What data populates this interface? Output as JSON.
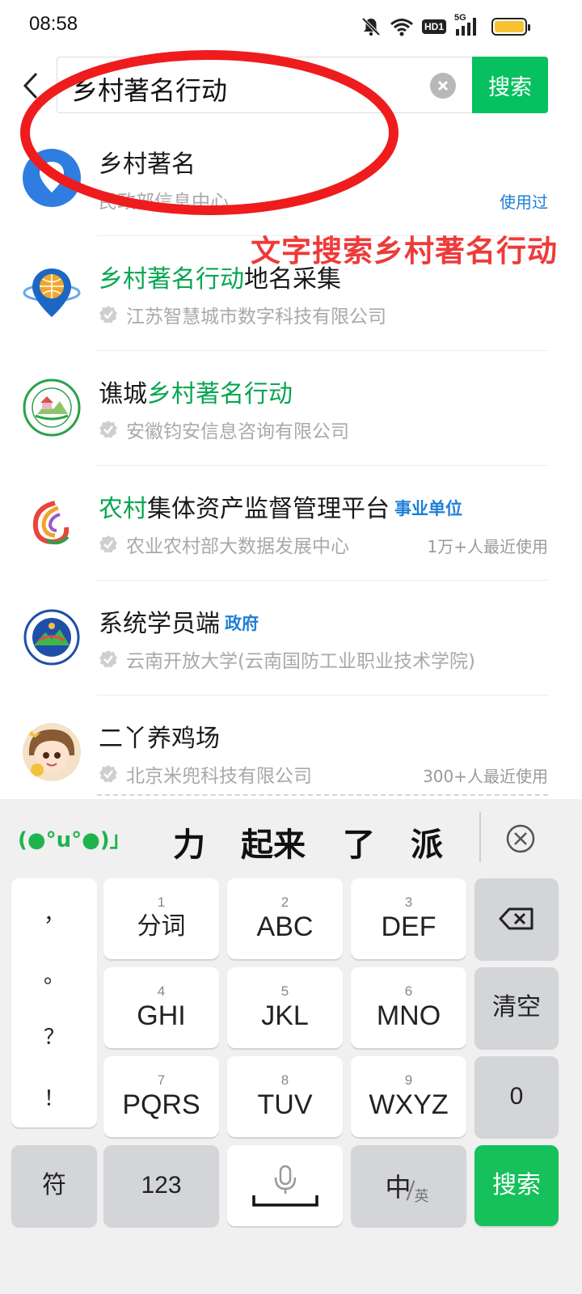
{
  "status_bar": {
    "time": "08:58",
    "network_badge": "HD1",
    "network_type": "5G",
    "battery_color": "#f6c233"
  },
  "search": {
    "query": "乡村著名行动",
    "button_label": "搜索"
  },
  "results": [
    {
      "title_parts": [
        {
          "text": "乡村著名",
          "highlight": false
        }
      ],
      "tag": "",
      "subtitle": "民政部信息中心",
      "verified": false,
      "meta": "使用过",
      "meta_style": "blue",
      "icon": "location-pin-icon"
    },
    {
      "title_parts": [
        {
          "text": "乡村著名行动",
          "highlight": true
        },
        {
          "text": "地名采集",
          "highlight": false
        }
      ],
      "tag": "",
      "subtitle": "江苏智慧城市数字科技有限公司",
      "verified": true,
      "meta": "",
      "icon": "globe-pin-icon"
    },
    {
      "title_parts": [
        {
          "text": "谯城",
          "highlight": false
        },
        {
          "text": "乡村著名行动",
          "highlight": true
        }
      ],
      "tag": "",
      "subtitle": "安徽钧安信息咨询有限公司",
      "verified": true,
      "meta": "",
      "icon": "village-seal-icon"
    },
    {
      "title_parts": [
        {
          "text": "农村",
          "highlight": true
        },
        {
          "text": "集体资产监督管理平台",
          "highlight": false
        }
      ],
      "tag": "事业单位",
      "subtitle": "农业农村部大数据发展中心",
      "verified": true,
      "meta": "1万+人最近使用",
      "icon": "swirl-logo-icon"
    },
    {
      "title_parts": [
        {
          "text": "系统学员端",
          "highlight": false
        }
      ],
      "tag": "政府",
      "subtitle": "云南开放大学(云南国防工业职业技术学院)",
      "verified": true,
      "meta": "",
      "icon": "school-emblem-icon"
    },
    {
      "title_parts": [
        {
          "text": "二丫养鸡场",
          "highlight": false
        }
      ],
      "tag": "",
      "subtitle": "北京米兜科技有限公司",
      "verified": true,
      "meta": "300+人最近使用",
      "icon": "cartoon-girl-avatar-icon"
    }
  ],
  "annotation": {
    "text": "文字搜索乡村著名行动",
    "color": "#ee3a3a"
  },
  "keyboard": {
    "emoticon": "(●°u°●)」",
    "candidates": [
      "力",
      "起来",
      "了",
      "派"
    ],
    "punctuation": [
      "，",
      "。",
      "？",
      "！"
    ],
    "keys": [
      {
        "num": "1",
        "label": "分词"
      },
      {
        "num": "2",
        "label": "ABC"
      },
      {
        "num": "3",
        "label": "DEF"
      },
      {
        "num": "4",
        "label": "GHI"
      },
      {
        "num": "5",
        "label": "JKL"
      },
      {
        "num": "6",
        "label": "MNO"
      },
      {
        "num": "7",
        "label": "PQRS"
      },
      {
        "num": "8",
        "label": "TUV"
      },
      {
        "num": "9",
        "label": "WXYZ"
      }
    ],
    "clear_label": "清空",
    "zero_label": "0",
    "symbol_label": "符",
    "num_label": "123",
    "lang_main": "中",
    "lang_sub": "英",
    "enter_label": "搜索",
    "accent": "#16c05a"
  }
}
